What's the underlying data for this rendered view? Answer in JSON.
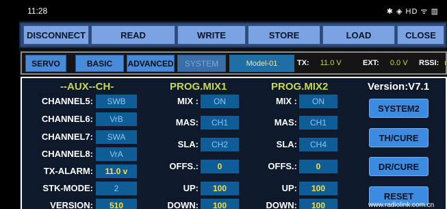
{
  "status": {
    "time": "11:28",
    "icons": "✱ ◈ HD ᯤ ▥"
  },
  "toolbar": {
    "disconnect": "DISCONNECT",
    "read": "READ",
    "write": "WRITE",
    "store": "STORE",
    "load": "LOAD",
    "close": "CLOSE"
  },
  "tabs": {
    "servo": "SERVO",
    "basic": "BASIC",
    "advanced": "ADVANCED",
    "system": "SYSTEM"
  },
  "info": {
    "model": "Model-01",
    "tx_label": "TX:",
    "tx_value": "11.0 V",
    "ext_label": "EXT:",
    "ext_value": "0.0 V",
    "rssi_label": "RSSI:",
    "rssi_value": "nul"
  },
  "aux": {
    "title": "--AUX--CH-",
    "rows": [
      {
        "label": "CHANNEL5:",
        "value": "SWB"
      },
      {
        "label": "CHANNEL6:",
        "value": "VrB"
      },
      {
        "label": "CHANNEL7:",
        "value": "SWA"
      },
      {
        "label": "CHANNEL8:",
        "value": "VrA"
      },
      {
        "label": "TX-ALARM:",
        "value": "11.0  v"
      },
      {
        "label": "STK-MODE:",
        "value": "2"
      },
      {
        "label": "VERSION:",
        "value": "510"
      }
    ]
  },
  "mix1": {
    "title": "PROG.MIX1",
    "rows": [
      {
        "label": "MIX :",
        "value": "ON"
      },
      {
        "label": "MAS:",
        "value": "CH1"
      },
      {
        "label": "SLA:",
        "value": "CH2"
      },
      {
        "label": "OFFS.:",
        "value": "0"
      },
      {
        "label": "UP:",
        "value": "100"
      },
      {
        "label": "DOWN:",
        "value": "100"
      }
    ]
  },
  "mix2": {
    "title": "PROG.MIX2",
    "rows": [
      {
        "label": "MIX :",
        "value": "ON"
      },
      {
        "label": "MAS:",
        "value": "CH1"
      },
      {
        "label": "SLA:",
        "value": "CH4"
      },
      {
        "label": "OFFS.:",
        "value": "0"
      },
      {
        "label": "UP:",
        "value": "100"
      },
      {
        "label": "DOWN:",
        "value": "100"
      }
    ]
  },
  "side": {
    "version": "Version:V7.1",
    "system2": "SYSTEM2",
    "th_cure": "TH/CURE",
    "dr_cure": "DR/CURE",
    "reset": "RESET",
    "url": "www.radiolink.com.cn"
  }
}
